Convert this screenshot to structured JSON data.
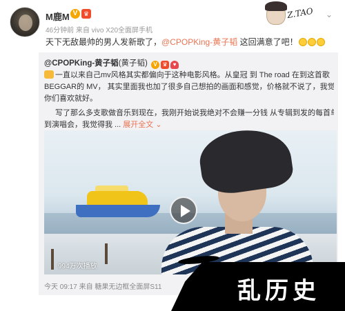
{
  "post": {
    "username": "M鹿M",
    "verified_badge": "V",
    "meta": "46分钟前 来自 vivo X20全面屏手机",
    "text_prefix": "天下无敌最帅的男人发新歌了，",
    "mention": "@CPOPKing-黄子韬",
    "text_suffix": " 这回满意了吧！",
    "emoji_count": 3
  },
  "header_decoration": {
    "signature": "Z.TAO",
    "icon": "chevron-down-icon"
  },
  "repost": {
    "author": "@CPOPKing-黄子韬",
    "author_alias": "(黄子韬)",
    "line1": "一直以来自己mv风格其实都偏向于这种电影风格。从皇冠 到 The road 在到这首歌",
    "line2": "BEGGAR的 MV， 其实里面我也加了很多自己想拍的画面和感觉，价格就不说了，我觉得只要",
    "line3": "你们喜欢就好。",
    "line4": "写了那么多支歌做音乐到现在，我刚开始说我绝对不会赚一分钱 从专辑到发的每首单曲",
    "line5": "到演唱会，我觉得我 ...",
    "expand_label": "展开全文",
    "expand_icon": "chevron-down-icon",
    "video_views": "994万次播放",
    "footer": "今天 09:17 来自 糖果无边框全面屏S11"
  },
  "watermark": {
    "text": "乱历史"
  },
  "colors": {
    "accent": "#eb7350",
    "repost_bg": "#f2f2f5",
    "meta_text": "#999999"
  }
}
